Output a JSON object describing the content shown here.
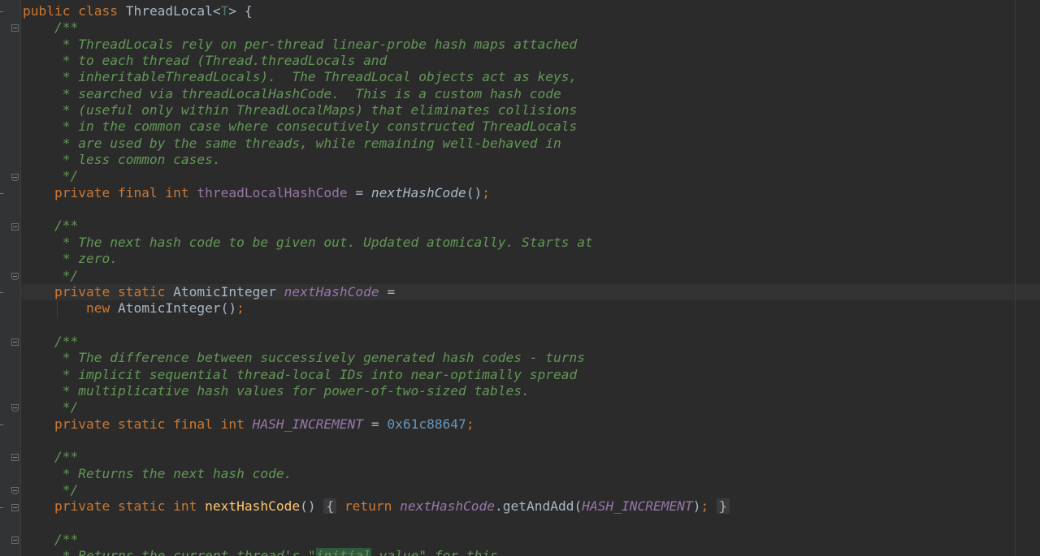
{
  "lines": [
    [
      {
        "t": "public class ",
        "c": "kw"
      },
      {
        "t": "ThreadLocal<",
        "c": "plain"
      },
      {
        "t": "T",
        "c": "tparam"
      },
      {
        "t": "> {",
        "c": "plain"
      }
    ],
    [
      {
        "t": "    /**",
        "c": "doc"
      }
    ],
    [
      {
        "t": "     * ThreadLocals rely on per-thread linear-probe hash maps attached",
        "c": "doc"
      }
    ],
    [
      {
        "t": "     * to each thread (Thread.threadLocals and",
        "c": "doc"
      }
    ],
    [
      {
        "t": "     * inheritableThreadLocals).  The ThreadLocal objects act as keys,",
        "c": "doc"
      }
    ],
    [
      {
        "t": "     * searched via threadLocalHashCode.  This is a custom hash code",
        "c": "doc"
      }
    ],
    [
      {
        "t": "     * (useful only within ThreadLocalMaps) that eliminates collisions",
        "c": "doc"
      }
    ],
    [
      {
        "t": "     * in the common case where consecutively constructed ThreadLocals",
        "c": "doc"
      }
    ],
    [
      {
        "t": "     * are used by the same threads, while remaining well-behaved in",
        "c": "doc"
      }
    ],
    [
      {
        "t": "     * less common cases.",
        "c": "doc"
      }
    ],
    [
      {
        "t": "     */",
        "c": "doc"
      }
    ],
    [
      {
        "t": "    private final int ",
        "c": "kw"
      },
      {
        "t": "threadLocalHashCode",
        "c": "fld"
      },
      {
        "t": " = ",
        "c": "plain"
      },
      {
        "t": "nextHashCode",
        "c": "smeth"
      },
      {
        "t": "()",
        "c": "plain"
      },
      {
        "t": ";",
        "c": "kw"
      }
    ],
    [],
    [
      {
        "t": "    /**",
        "c": "doc"
      }
    ],
    [
      {
        "t": "     * The next hash code to be given out. Updated atomically. Starts at",
        "c": "doc"
      }
    ],
    [
      {
        "t": "     * zero.",
        "c": "doc"
      }
    ],
    [
      {
        "t": "     */",
        "c": "doc"
      }
    ],
    [
      {
        "t": "    private static ",
        "c": "kw"
      },
      {
        "t": "AtomicInteger ",
        "c": "plain"
      },
      {
        "t": "nextHashCode",
        "c": "sfld"
      },
      {
        "t": " =",
        "c": "plain"
      }
    ],
    [
      {
        "t": "        new ",
        "c": "kw"
      },
      {
        "t": "AtomicInteger()",
        "c": "plain"
      },
      {
        "t": ";",
        "c": "kw"
      }
    ],
    [],
    [
      {
        "t": "    /**",
        "c": "doc"
      }
    ],
    [
      {
        "t": "     * The difference between successively generated hash codes - turns",
        "c": "doc"
      }
    ],
    [
      {
        "t": "     * implicit sequential thread-local IDs into near-optimally spread",
        "c": "doc"
      }
    ],
    [
      {
        "t": "     * multiplicative hash values for power-of-two-sized tables.",
        "c": "doc"
      }
    ],
    [
      {
        "t": "     */",
        "c": "doc"
      }
    ],
    [
      {
        "t": "    private static final int ",
        "c": "kw"
      },
      {
        "t": "HASH_INCREMENT",
        "c": "sfld"
      },
      {
        "t": " = ",
        "c": "plain"
      },
      {
        "t": "0x61c88647",
        "c": "num"
      },
      {
        "t": ";",
        "c": "kw"
      }
    ],
    [],
    [
      {
        "t": "    /**",
        "c": "doc"
      }
    ],
    [
      {
        "t": "     * Returns the next hash code.",
        "c": "doc"
      }
    ],
    [
      {
        "t": "     */",
        "c": "doc"
      }
    ],
    [
      {
        "t": "    private static int ",
        "c": "kw"
      },
      {
        "t": "nextHashCode",
        "c": "meth"
      },
      {
        "t": "() ",
        "c": "plain"
      },
      {
        "t": "{",
        "c": "fold-block"
      },
      {
        "t": " ",
        "c": "plain"
      },
      {
        "t": "return ",
        "c": "kw"
      },
      {
        "t": "nextHashCode",
        "c": "sfld"
      },
      {
        "t": ".getAndAdd(",
        "c": "plain"
      },
      {
        "t": "HASH_INCREMENT",
        "c": "sfld"
      },
      {
        "t": ")",
        "c": "plain"
      },
      {
        "t": ";",
        "c": "kw"
      },
      {
        "t": " ",
        "c": "plain"
      },
      {
        "t": "}",
        "c": "fold-block"
      }
    ],
    [],
    [
      {
        "t": "    /**",
        "c": "doc"
      }
    ],
    [
      {
        "t": "     * Returns the current thread's \"",
        "c": "doc"
      },
      {
        "t": "initial",
        "c": "doc highlight-word"
      },
      {
        "t": " value\" for this",
        "c": "doc"
      }
    ]
  ]
}
